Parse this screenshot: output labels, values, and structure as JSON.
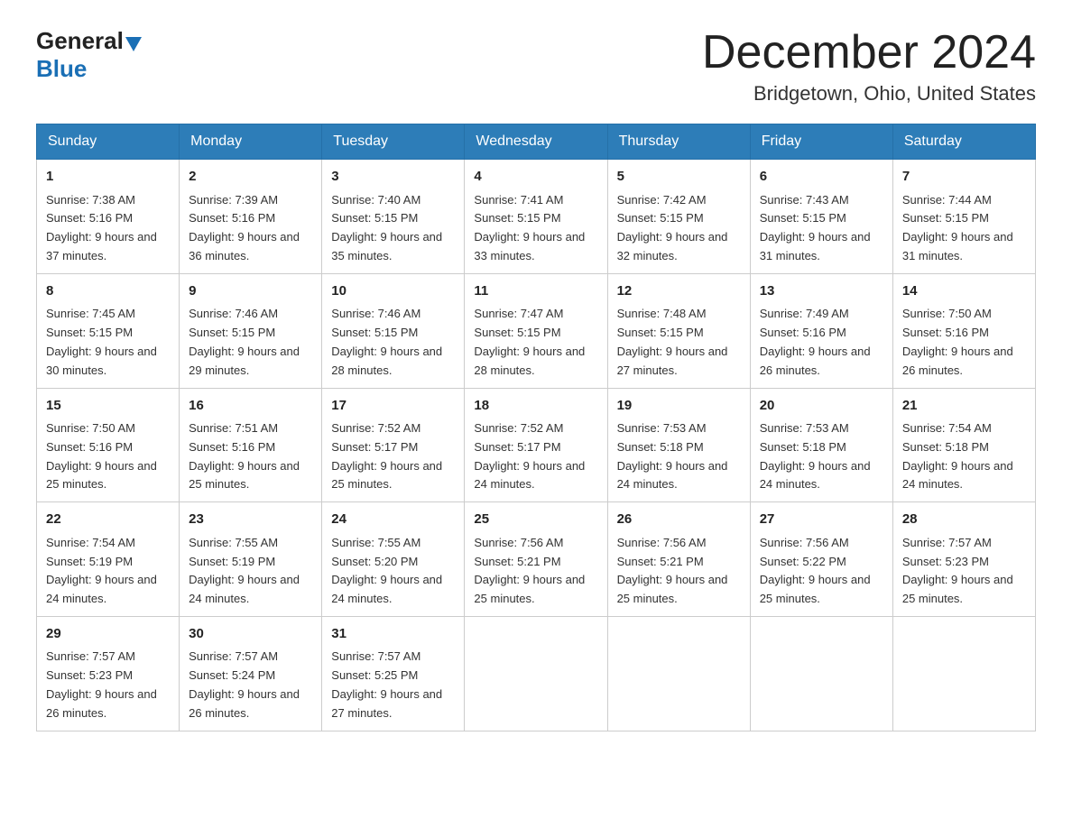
{
  "header": {
    "logo_general": "General",
    "logo_blue": "Blue",
    "main_title": "December 2024",
    "subtitle": "Bridgetown, Ohio, United States"
  },
  "calendar": {
    "days_of_week": [
      "Sunday",
      "Monday",
      "Tuesday",
      "Wednesday",
      "Thursday",
      "Friday",
      "Saturday"
    ],
    "weeks": [
      [
        {
          "day": "1",
          "sunrise": "7:38 AM",
          "sunset": "5:16 PM",
          "daylight": "9 hours and 37 minutes."
        },
        {
          "day": "2",
          "sunrise": "7:39 AM",
          "sunset": "5:16 PM",
          "daylight": "9 hours and 36 minutes."
        },
        {
          "day": "3",
          "sunrise": "7:40 AM",
          "sunset": "5:15 PM",
          "daylight": "9 hours and 35 minutes."
        },
        {
          "day": "4",
          "sunrise": "7:41 AM",
          "sunset": "5:15 PM",
          "daylight": "9 hours and 33 minutes."
        },
        {
          "day": "5",
          "sunrise": "7:42 AM",
          "sunset": "5:15 PM",
          "daylight": "9 hours and 32 minutes."
        },
        {
          "day": "6",
          "sunrise": "7:43 AM",
          "sunset": "5:15 PM",
          "daylight": "9 hours and 31 minutes."
        },
        {
          "day": "7",
          "sunrise": "7:44 AM",
          "sunset": "5:15 PM",
          "daylight": "9 hours and 31 minutes."
        }
      ],
      [
        {
          "day": "8",
          "sunrise": "7:45 AM",
          "sunset": "5:15 PM",
          "daylight": "9 hours and 30 minutes."
        },
        {
          "day": "9",
          "sunrise": "7:46 AM",
          "sunset": "5:15 PM",
          "daylight": "9 hours and 29 minutes."
        },
        {
          "day": "10",
          "sunrise": "7:46 AM",
          "sunset": "5:15 PM",
          "daylight": "9 hours and 28 minutes."
        },
        {
          "day": "11",
          "sunrise": "7:47 AM",
          "sunset": "5:15 PM",
          "daylight": "9 hours and 28 minutes."
        },
        {
          "day": "12",
          "sunrise": "7:48 AM",
          "sunset": "5:15 PM",
          "daylight": "9 hours and 27 minutes."
        },
        {
          "day": "13",
          "sunrise": "7:49 AM",
          "sunset": "5:16 PM",
          "daylight": "9 hours and 26 minutes."
        },
        {
          "day": "14",
          "sunrise": "7:50 AM",
          "sunset": "5:16 PM",
          "daylight": "9 hours and 26 minutes."
        }
      ],
      [
        {
          "day": "15",
          "sunrise": "7:50 AM",
          "sunset": "5:16 PM",
          "daylight": "9 hours and 25 minutes."
        },
        {
          "day": "16",
          "sunrise": "7:51 AM",
          "sunset": "5:16 PM",
          "daylight": "9 hours and 25 minutes."
        },
        {
          "day": "17",
          "sunrise": "7:52 AM",
          "sunset": "5:17 PM",
          "daylight": "9 hours and 25 minutes."
        },
        {
          "day": "18",
          "sunrise": "7:52 AM",
          "sunset": "5:17 PM",
          "daylight": "9 hours and 24 minutes."
        },
        {
          "day": "19",
          "sunrise": "7:53 AM",
          "sunset": "5:18 PM",
          "daylight": "9 hours and 24 minutes."
        },
        {
          "day": "20",
          "sunrise": "7:53 AM",
          "sunset": "5:18 PM",
          "daylight": "9 hours and 24 minutes."
        },
        {
          "day": "21",
          "sunrise": "7:54 AM",
          "sunset": "5:18 PM",
          "daylight": "9 hours and 24 minutes."
        }
      ],
      [
        {
          "day": "22",
          "sunrise": "7:54 AM",
          "sunset": "5:19 PM",
          "daylight": "9 hours and 24 minutes."
        },
        {
          "day": "23",
          "sunrise": "7:55 AM",
          "sunset": "5:19 PM",
          "daylight": "9 hours and 24 minutes."
        },
        {
          "day": "24",
          "sunrise": "7:55 AM",
          "sunset": "5:20 PM",
          "daylight": "9 hours and 24 minutes."
        },
        {
          "day": "25",
          "sunrise": "7:56 AM",
          "sunset": "5:21 PM",
          "daylight": "9 hours and 25 minutes."
        },
        {
          "day": "26",
          "sunrise": "7:56 AM",
          "sunset": "5:21 PM",
          "daylight": "9 hours and 25 minutes."
        },
        {
          "day": "27",
          "sunrise": "7:56 AM",
          "sunset": "5:22 PM",
          "daylight": "9 hours and 25 minutes."
        },
        {
          "day": "28",
          "sunrise": "7:57 AM",
          "sunset": "5:23 PM",
          "daylight": "9 hours and 25 minutes."
        }
      ],
      [
        {
          "day": "29",
          "sunrise": "7:57 AM",
          "sunset": "5:23 PM",
          "daylight": "9 hours and 26 minutes."
        },
        {
          "day": "30",
          "sunrise": "7:57 AM",
          "sunset": "5:24 PM",
          "daylight": "9 hours and 26 minutes."
        },
        {
          "day": "31",
          "sunrise": "7:57 AM",
          "sunset": "5:25 PM",
          "daylight": "9 hours and 27 minutes."
        },
        null,
        null,
        null,
        null
      ]
    ]
  }
}
